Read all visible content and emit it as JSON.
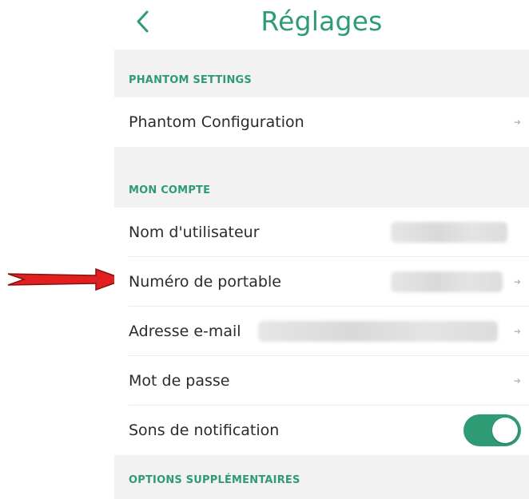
{
  "header": {
    "title": "Réglages",
    "back_icon": "chevron-left-icon"
  },
  "sections": {
    "phantom": {
      "label": "PHANTOM SETTINGS"
    },
    "account": {
      "label": "MON COMPTE"
    },
    "extra": {
      "label": "OPTIONS SUPPLÉMENTAIRES"
    }
  },
  "rows": {
    "phantom_config": {
      "label": "Phantom Configuration"
    },
    "username": {
      "label": "Nom d'utilisateur"
    },
    "phone": {
      "label": "Numéro de portable"
    },
    "email": {
      "label": "Adresse e-mail"
    },
    "password": {
      "label": "Mot de passe"
    },
    "notification_sounds": {
      "label": "Sons de notification",
      "enabled": true
    }
  },
  "colors": {
    "accent": "#2f9b74",
    "section_background": "#f2f2f2",
    "annotation_arrow": "#e02020"
  }
}
